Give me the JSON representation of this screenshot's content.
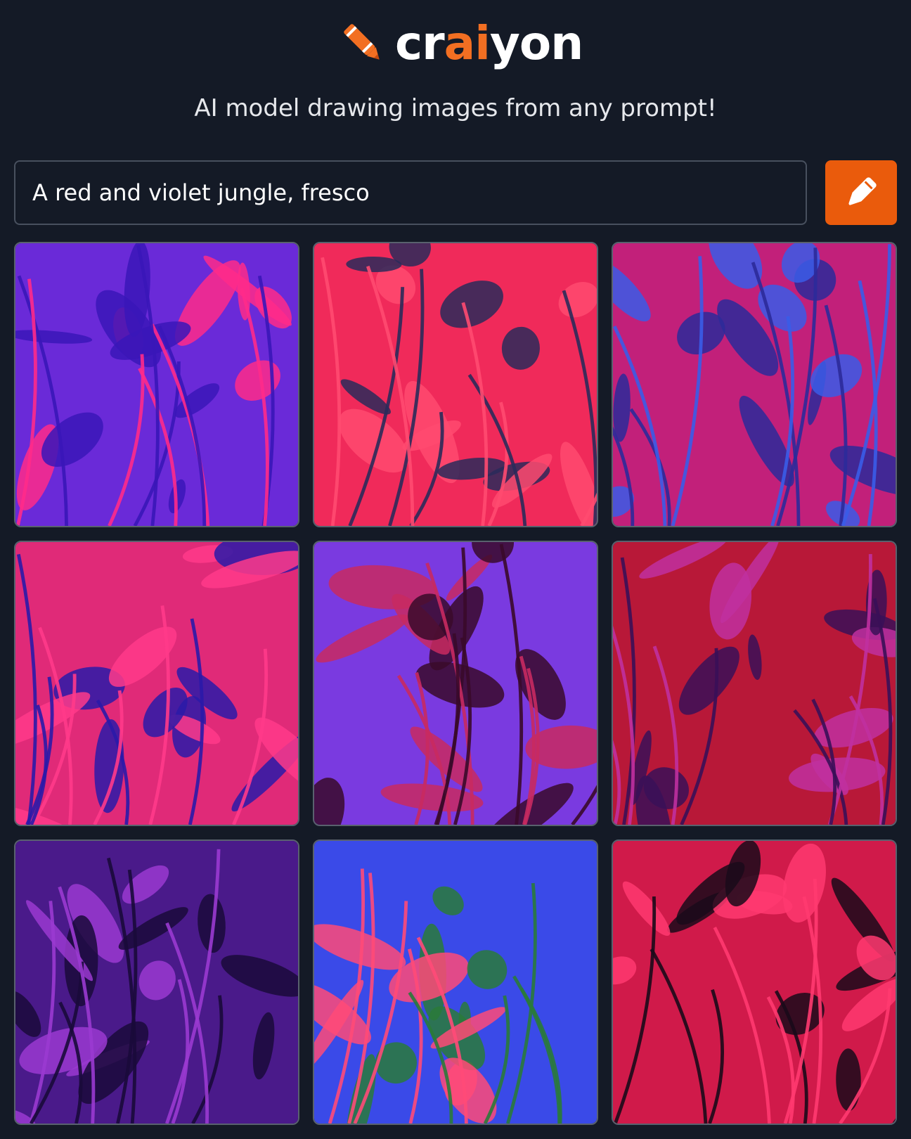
{
  "brand": {
    "logo_prefix": "cr",
    "logo_ai": "ai",
    "logo_suffix": "yon",
    "tagline": "AI model drawing images from any prompt!",
    "accent": "#f26f22"
  },
  "prompt": {
    "value": "A red and violet jungle, fresco",
    "placeholder": ""
  },
  "draw_button": {
    "icon": "pencil-icon",
    "color": "#ea5b0c"
  },
  "results": [
    {
      "name": "violet jungle with pink fronds",
      "bg": "#6a2ad8",
      "accent": "#ff2a8a",
      "leaf": "#3a16b8"
    },
    {
      "name": "red jungle with dark striped leaves",
      "bg": "#f02a5a",
      "accent": "#ff4a70",
      "leaf": "#2a2a5a"
    },
    {
      "name": "magenta jungle with blue leaves",
      "bg": "#c2207a",
      "accent": "#3a5ce8",
      "leaf": "#2c2a9a"
    },
    {
      "name": "pink and blue striped fronds",
      "bg": "#e02a78",
      "accent": "#ff3a8a",
      "leaf": "#2a1aa8"
    },
    {
      "name": "dark red forest under violet sky",
      "bg": "#7a3ae0",
      "accent": "#c82a60",
      "leaf": "#3a0a2a"
    },
    {
      "name": "crimson jungle with violet palms",
      "bg": "#b81838",
      "accent": "#c030a0",
      "leaf": "#3a1058"
    },
    {
      "name": "deep violet foliage",
      "bg": "#4a1a8a",
      "accent": "#9a3ad0",
      "leaf": "#1a0a3a"
    },
    {
      "name": "blue and coral banana leaves",
      "bg": "#3a4ae8",
      "accent": "#ff4a78",
      "leaf": "#2a7a3a"
    },
    {
      "name": "crimson palm fronds",
      "bg": "#d01a4a",
      "accent": "#ff3a70",
      "leaf": "#1a0a1a"
    }
  ]
}
